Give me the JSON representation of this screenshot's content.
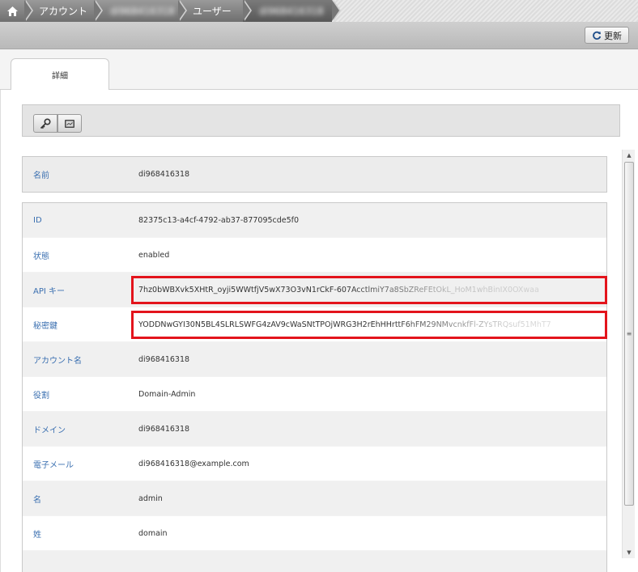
{
  "breadcrumb": {
    "items": [
      {
        "label": "アカウント"
      },
      {
        "label": "di968416318"
      },
      {
        "label": "ユーザー"
      },
      {
        "label": "di968416318"
      }
    ]
  },
  "actions": {
    "refresh_label": "更新"
  },
  "tabs": [
    {
      "label": "詳細"
    }
  ],
  "toolbar": {
    "buttons": [
      {
        "icon": "key-icon"
      },
      {
        "icon": "console-icon"
      }
    ]
  },
  "user": {
    "name_label": "名前",
    "name_value": "di968416318"
  },
  "details": [
    {
      "label": "ID",
      "value": "82375c13-a4cf-4792-ab37-877095cde5f0"
    },
    {
      "label": "状態",
      "value": "enabled"
    },
    {
      "label": "API キー",
      "value": "7hz0bWBXvk5XHtR_oyji5WWtfjV5wX73O3vN1rCkF-607AcctlmiY7a8SbZReFEtOkL_HoM1whBinIX0OXwaa"
    },
    {
      "label": "秘密鍵",
      "value": "YODDNwGYI30N5BL4SLRLSWFG4zAV9cWaSNtTPOjWRG3H2rEhHHrttF6hFM29NMvcnkfFl-ZYsTRQsuf51MhT7"
    },
    {
      "label": "アカウント名",
      "value": "di968416318"
    },
    {
      "label": "役割",
      "value": "Domain-Admin"
    },
    {
      "label": "ドメイン",
      "value": "di968416318"
    },
    {
      "label": "電子メール",
      "value": "di968416318@example.com"
    },
    {
      "label": "名",
      "value": "admin"
    },
    {
      "label": "姓",
      "value": "domain"
    }
  ],
  "colors": {
    "label": "#3a6fb0",
    "highlight": "#e3141c"
  }
}
